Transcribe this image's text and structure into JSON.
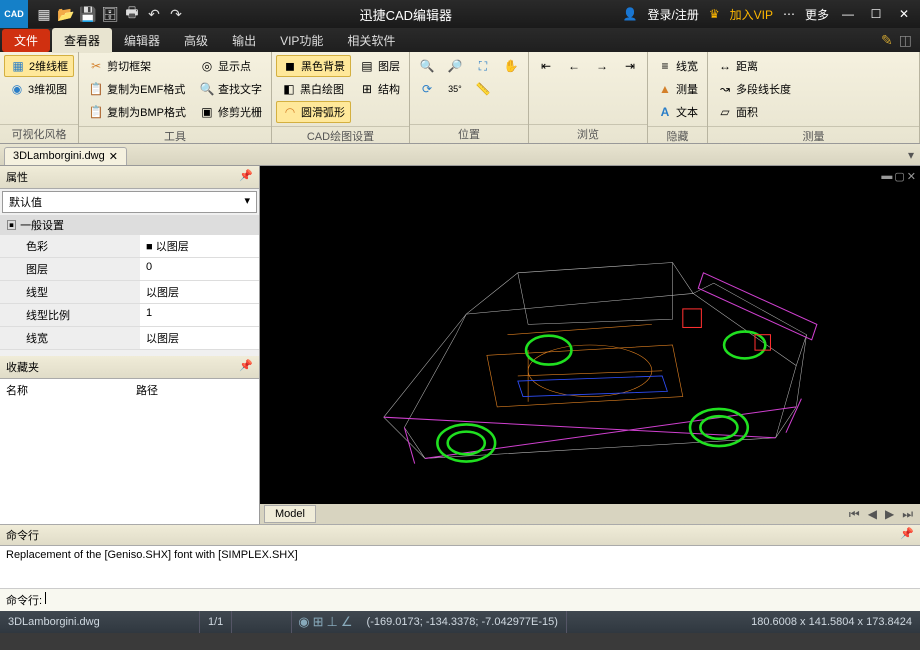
{
  "titlebar": {
    "logo": "CAD",
    "title": "迅捷CAD编辑器",
    "login": "登录/注册",
    "vip": "加入VIP",
    "more": "更多"
  },
  "menu": {
    "tabs": [
      "文件",
      "查看器",
      "编辑器",
      "高级",
      "输出",
      "VIP功能",
      "相关软件"
    ]
  },
  "ribbon": {
    "g1": {
      "label": "可视化风格",
      "b1": "2维线框",
      "b2": "3维视图"
    },
    "g2": {
      "label": "工具",
      "b1": "剪切框架",
      "b2": "复制为EMF格式",
      "b3": "复制为BMP格式",
      "b4": "显示点",
      "b5": "查找文字",
      "b6": "修剪光栅"
    },
    "g3": {
      "label": "CAD绘图设置",
      "b1": "黑色背景",
      "b2": "黑白绘图",
      "b3": "圆滑弧形",
      "b4": "图层",
      "b5": "结构"
    },
    "g4": {
      "label": "位置"
    },
    "g5": {
      "label": "浏览"
    },
    "g6": {
      "label": "隐藏",
      "b1": "线宽",
      "b2": "测量",
      "b3": "文本"
    },
    "g7": {
      "label": "测量",
      "b1": "距离",
      "b2": "多段线长度",
      "b3": "面积"
    }
  },
  "file": {
    "name": "3DLamborgini.dwg"
  },
  "props": {
    "title": "属性",
    "default": "默认值",
    "section": "一般设置",
    "rows": [
      {
        "k": "色彩",
        "v": "■ 以图层"
      },
      {
        "k": "图层",
        "v": "0"
      },
      {
        "k": "线型",
        "v": "以图层"
      },
      {
        "k": "线型比例",
        "v": "1"
      },
      {
        "k": "线宽",
        "v": "以图层"
      }
    ]
  },
  "fav": {
    "title": "收藏夹",
    "col1": "名称",
    "col2": "路径"
  },
  "viewport": {
    "model": "Model"
  },
  "cmd": {
    "title": "命令行",
    "body": "Replacement of the [Geniso.SHX] font with [SIMPLEX.SHX]",
    "prompt": "命令行:"
  },
  "status": {
    "file": "3DLamborgini.dwg",
    "page": "1/1",
    "coords": "(-169.0173; -134.3378; -7.042977E-15)",
    "dims": "180.6008 x 141.5804 x 173.8424"
  }
}
